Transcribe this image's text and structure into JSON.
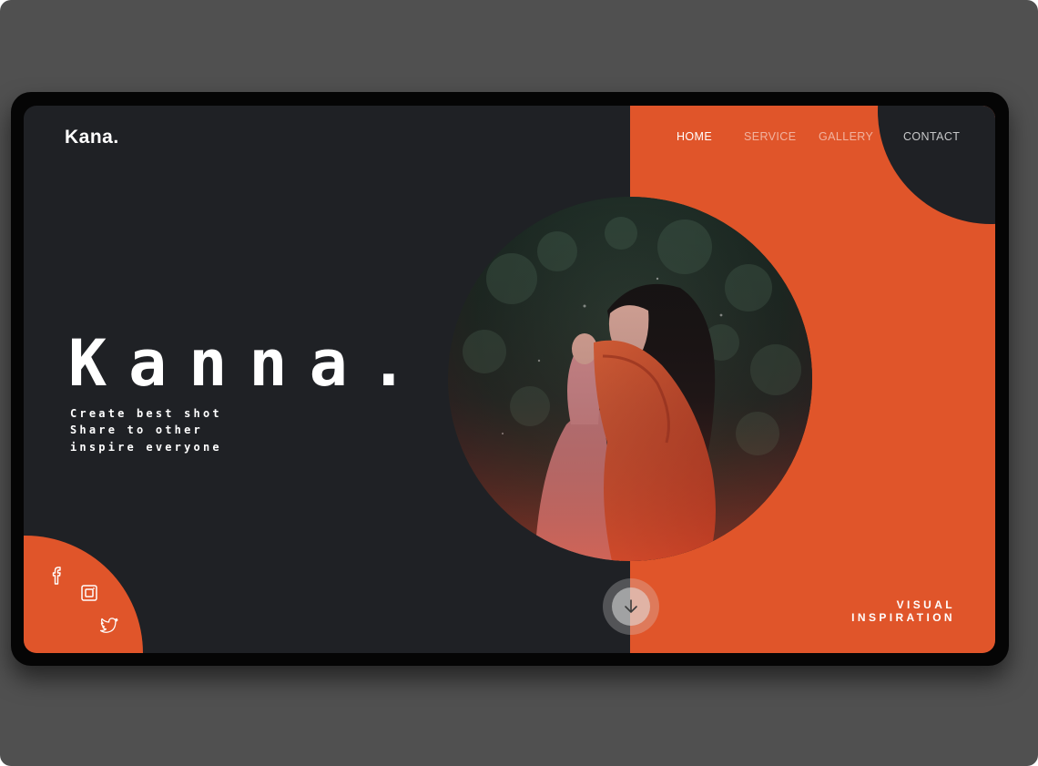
{
  "brand": {
    "logo": "Kana."
  },
  "nav": {
    "items": [
      {
        "label": "HOME",
        "active": true
      },
      {
        "label": "SERVICE",
        "active": false
      },
      {
        "label": "GALLERY",
        "active": false
      },
      {
        "label": "CONTACT",
        "active": false
      }
    ]
  },
  "hero": {
    "title": "Kanna.",
    "tagline": [
      "Create best shot",
      "Share to other",
      "inspire everyone"
    ]
  },
  "photo": {
    "subject": "woman-with-orange-scarf"
  },
  "scroll": {
    "icon": "arrow-down-icon"
  },
  "footer_text": {
    "line1": "VISUAL",
    "line2": "INSPIRATION"
  },
  "social": {
    "icons": [
      "facebook-icon",
      "instagram-icon",
      "twitter-icon"
    ]
  },
  "colors": {
    "accent": "#e0552a",
    "dark": "#1f2125",
    "frame": "#505050",
    "text": "#ffffff"
  }
}
